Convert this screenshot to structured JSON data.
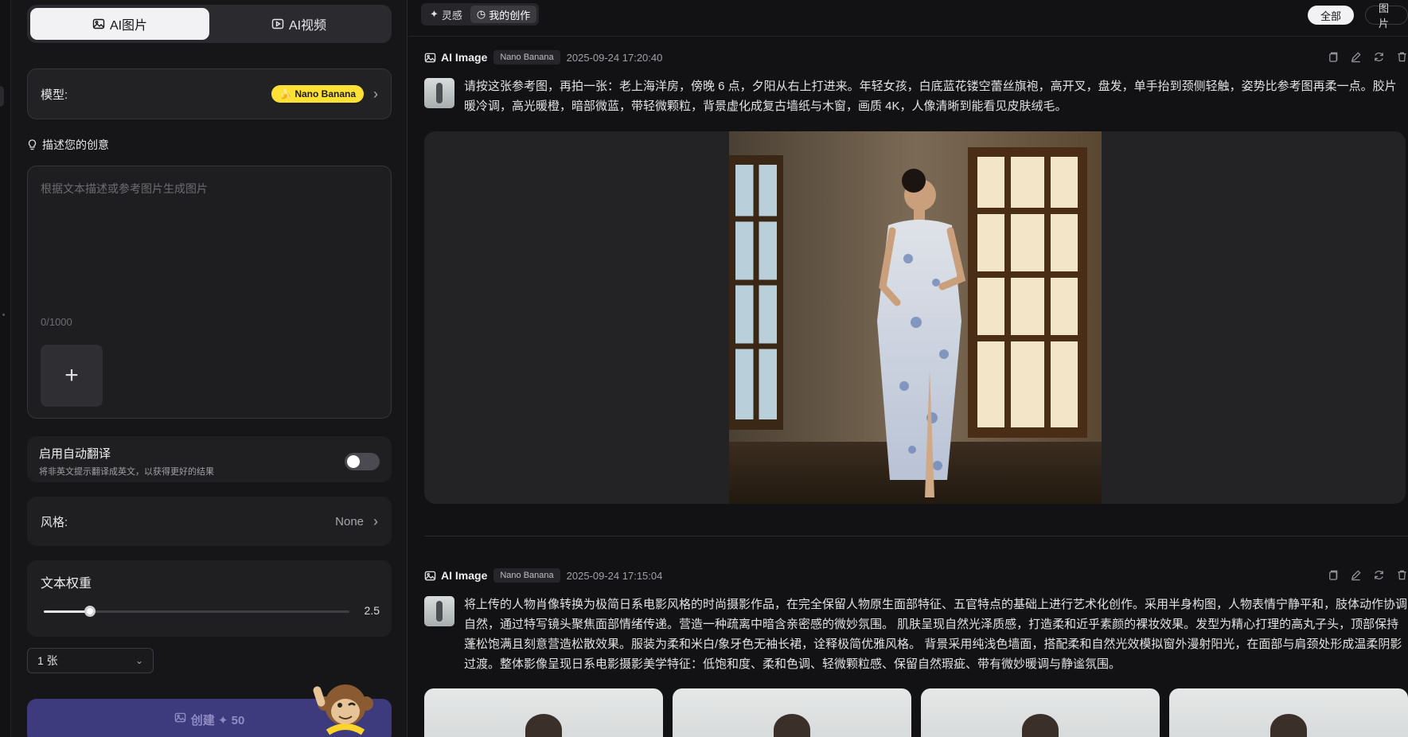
{
  "mode_tabs": {
    "image": "AI图片",
    "video": "AI视频"
  },
  "model": {
    "label": "模型:",
    "name": "Nano Banana"
  },
  "prompt": {
    "section_title": "描述您的创意",
    "placeholder": "根据文本描述或参考图片生成图片",
    "counter": "0/1000",
    "add_icon": "+"
  },
  "translate": {
    "title": "启用自动翻译",
    "description": "将非英文提示翻译成英文，以获得更好的结果",
    "enabled": false
  },
  "style": {
    "label": "风格:",
    "value": "None"
  },
  "text_weight": {
    "title": "文本权重",
    "value": "2.5",
    "fraction": 0.15
  },
  "count": {
    "value": "1 张"
  },
  "create": {
    "label": "创建 ✦ 50"
  },
  "topbar": {
    "inspiration": "灵感",
    "my_creations": "我的创作",
    "filter_all": "全部",
    "filter_image": "图片"
  },
  "entries": [
    {
      "type": "AI Image",
      "model": "Nano Banana",
      "time": "2025-09-24 17:20:40",
      "prompt": "请按这张参考图，再拍一张：老上海洋房，傍晚 6 点，夕阳从右上打进来。年轻女孩，白底蓝花镂空蕾丝旗袍，高开叉，盘发，单手抬到颈侧轻触，姿势比参考图再柔一点。胶片暖冷调，高光暖橙，暗部微蓝，带轻微颗粒，背景虚化成复古墙纸与木窗，画质 4K，人像清晰到能看见皮肤绒毛。"
    },
    {
      "type": "AI Image",
      "model": "Nano Banana",
      "time": "2025-09-24 17:15:04",
      "prompt": "将上传的人物肖像转换为极简日系电影风格的时尚摄影作品，在完全保留人物原生面部特征、五官特点的基础上进行艺术化创作。采用半身构图，人物表情宁静平和，肢体动作协调自然，通过特写镜头聚焦面部情绪传递。营造一种疏离中暗含亲密感的微妙氛围。 肌肤呈现自然光泽质感，打造柔和近乎素颜的裸妆效果。发型为精心打理的高丸子头，顶部保持蓬松饱满且刻意营造松散效果。服装为柔和米白/象牙色无袖长裙，诠释极简优雅风格。 背景采用纯浅色墙面，搭配柔和自然光效模拟窗外漫射阳光，在面部与肩颈处形成温柔阴影过渡。整体影像呈现日系电影摄影美学特征：低饱和度、柔和色调、轻微颗粒感、保留自然瑕疵、带有微妙暖调与静谧氛围。"
    }
  ],
  "colors": {
    "accent": "#3d3b7e",
    "badge": "#ffe135",
    "background": "#121214"
  }
}
